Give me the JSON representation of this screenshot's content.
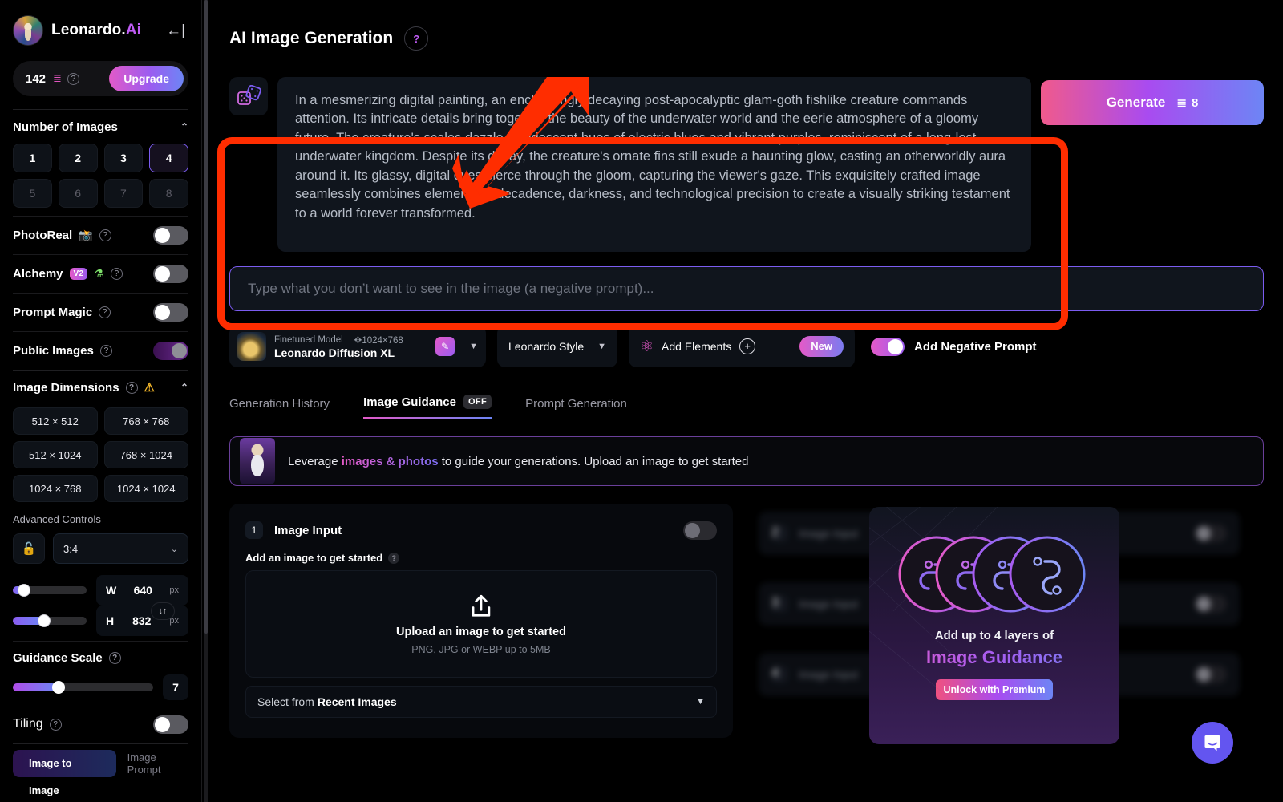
{
  "sidebar": {
    "brand": {
      "name_main": "Leonardo.",
      "name_accent": "Ai",
      "collapse_icon": "←|"
    },
    "credits": {
      "count": "142",
      "coin_icon": "≣",
      "help": "?",
      "upgrade_label": "Upgrade"
    },
    "number_of_images": {
      "title": "Number of Images",
      "chevron": "⌃",
      "options": [
        "1",
        "2",
        "3",
        "4",
        "5",
        "6",
        "7",
        "8"
      ],
      "selected": "4",
      "disabled_from_index": 4
    },
    "toggles": [
      {
        "label": "PhotoReal",
        "help": "?",
        "emoji": "📸",
        "state": "off"
      },
      {
        "label": "Alchemy",
        "help": "?",
        "badge": "V2",
        "emoji": "⚗",
        "state": "off"
      },
      {
        "label": "Prompt Magic",
        "help": "?",
        "state": "off"
      },
      {
        "label": "Public Images",
        "help": "?",
        "state": "on"
      }
    ],
    "image_dimensions": {
      "title": "Image Dimensions",
      "help": "?",
      "warning_icon": "⚠",
      "chevron": "⌃",
      "presets": [
        "512 × 512",
        "768 × 768",
        "512 × 1024",
        "768 × 1024",
        "1024 × 768",
        "1024 × 1024"
      ]
    },
    "advanced_controls": {
      "label": "Advanced Controls",
      "lock_icon": "🔓",
      "aspect_ratio": "3:4",
      "aspect_chevron": "⌄",
      "swap_icon": "↓↑",
      "width": {
        "key": "W",
        "value": "640",
        "unit": "px",
        "slider_percent": 12
      },
      "height": {
        "key": "H",
        "value": "832",
        "unit": "px",
        "slider_percent": 40
      }
    },
    "guidance_scale": {
      "title": "Guidance Scale",
      "help": "?",
      "value": "7",
      "slider_percent": 31
    },
    "tiling": {
      "label": "Tiling",
      "help": "?",
      "state": "off"
    },
    "bottom_tabs": [
      {
        "label": "Image to Image",
        "active": true
      },
      {
        "label": "Image Prompt",
        "active": false
      }
    ]
  },
  "main": {
    "page_title": "AI Image Generation",
    "page_help": "?",
    "dice_icon": "🎲",
    "prompt": "In a mesmerizing digital painting, an enchantingly decaying post-apocalyptic glam-goth fishlike creature commands attention. Its intricate details bring together the beauty of the underwater world and the eerie atmosphere of a gloomy future. The creature's scales dazzle in iridescent hues of electric blues and vibrant purples, reminiscent of a long-lost underwater kingdom. Despite its decay, the creature's ornate fins still exude a haunting glow, casting an otherworldly aura around it. Its glassy, digital eyes pierce through the gloom, capturing the viewer's gaze. This exquisitely crafted image seamlessly combines elements of decadence, darkness, and technological precision to create a visually striking testament to a world forever transformed.",
    "generate": {
      "label": "Generate",
      "cost": "8",
      "coin_icon": "≣"
    },
    "negative_prompt_placeholder": "Type what you don’t want to see in the image (a negative prompt)...",
    "model": {
      "kind_label": "Finetuned Model",
      "resolution": "1024×768",
      "move_icon": "✥",
      "name": "Leonardo Diffusion XL",
      "edit_icon": "✎",
      "caret": "▼"
    },
    "style": {
      "label": "Leonardo Style",
      "caret": "▼"
    },
    "elements": {
      "label": "Add Elements",
      "plus": "+",
      "badge": "New",
      "atom_icon": "⚛"
    },
    "negative_prompt_toggle": {
      "label": "Add Negative Prompt",
      "state": "on"
    },
    "tabs": [
      {
        "label": "Generation History",
        "active": false
      },
      {
        "label": "Image Guidance",
        "active": true,
        "chip": "OFF"
      },
      {
        "label": "Prompt Generation",
        "active": false
      }
    ],
    "leverage_banner": {
      "prefix": "Leverage ",
      "highlight": "images & photos",
      "suffix": " to guide your generations. Upload an image to get started"
    },
    "image_input": {
      "number": "1",
      "title": "Image Input",
      "toggle_state": "off",
      "sub_label": "Add an image to get started",
      "sub_help": "?",
      "drop_main": "Upload an image to get started",
      "drop_sub": "PNG, JPG or WEBP up to 5MB",
      "recent_prefix": "Select from ",
      "recent_strong": "Recent Images",
      "recent_chevron": "▼"
    },
    "ghost_rows": [
      {
        "number": "2",
        "title": "Image Input"
      },
      {
        "number": "3",
        "title": "Image Input"
      },
      {
        "number": "4",
        "title": "Image Input"
      }
    ],
    "premium_card": {
      "line1": "Add up to 4 layers of",
      "line2": "Image Guidance",
      "button": "Unlock with Premium"
    },
    "intercom_label": "chat-bubble-icon"
  },
  "colors": {
    "accent_pink": "#e45ac8",
    "accent_purple": "#9b5cf0",
    "accent_blue": "#6d85f5",
    "annotation_red": "#ff2d00",
    "background": "#000000",
    "panel": "#10151d"
  }
}
